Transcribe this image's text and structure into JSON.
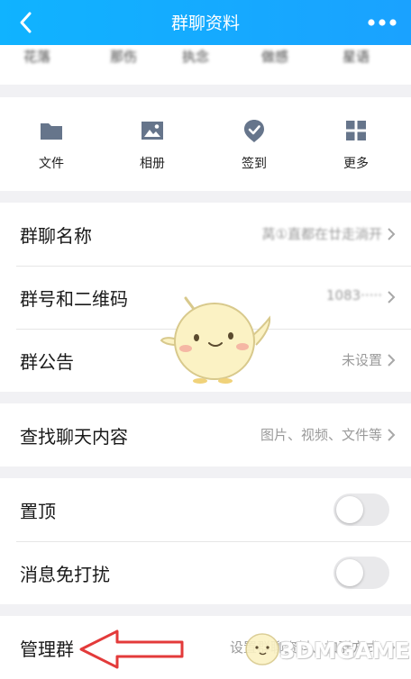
{
  "header": {
    "title": "群聊资料"
  },
  "members_strip": [
    "花落",
    "那伤",
    "执念",
    "做感",
    "星语"
  ],
  "tools": [
    {
      "label": "文件",
      "icon": "folder-icon"
    },
    {
      "label": "相册",
      "icon": "image-icon"
    },
    {
      "label": "签到",
      "icon": "checkin-icon"
    },
    {
      "label": "更多",
      "icon": "grid-icon"
    }
  ],
  "info": {
    "name_label": "群聊名称",
    "name_value": "莴①直都在廿走淌开",
    "number_label": "群号和二维码",
    "number_value": "1083·····",
    "notice_label": "群公告",
    "notice_value": "未设置"
  },
  "search": {
    "label": "查找聊天内容",
    "value": "图片、视频、文件等"
  },
  "settings": {
    "pin_label": "置顶",
    "mute_label": "消息免打扰"
  },
  "manage": {
    "label": "管理群",
    "value": "设置群聊资料、加群方式"
  },
  "watermark": {
    "text": "3DMGAME"
  },
  "colors": {
    "header": "#1aa2ff",
    "icon": "#66758b",
    "arrow": "#e33a3a"
  }
}
